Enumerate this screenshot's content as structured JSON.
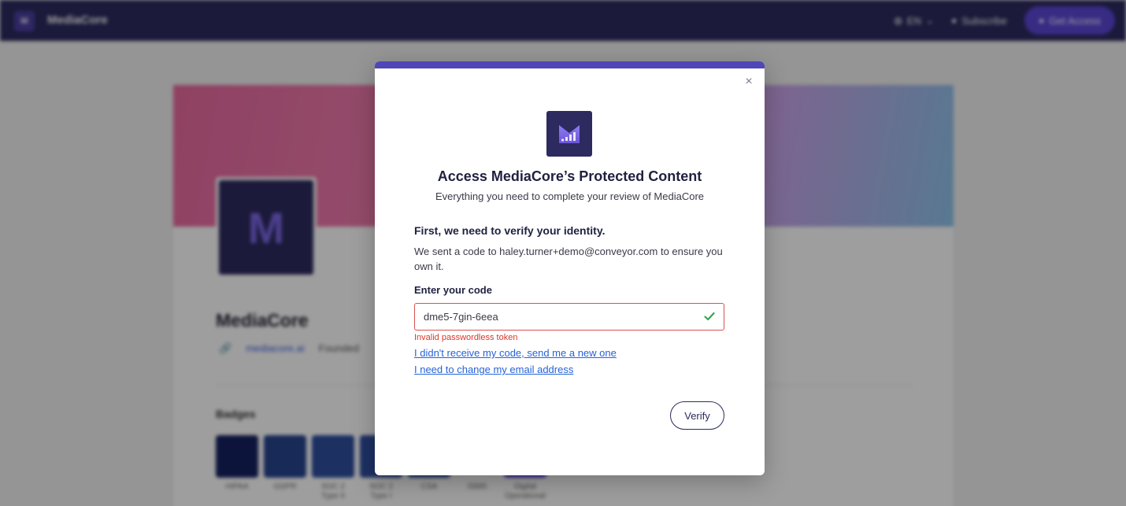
{
  "nav": {
    "brand": "MediaCore",
    "lang": "EN",
    "subscribe": "Subscribe",
    "get_access": "Get Access"
  },
  "company": {
    "name": "MediaCore",
    "website": "mediacore.ai",
    "founded": "Founded"
  },
  "badges": {
    "heading": "Badges",
    "items": [
      "HIPAA",
      "GDPR",
      "SOC 2 Type II",
      "SOC 2 Type I",
      "CSA",
      "ISMS",
      "Digital Operational"
    ]
  },
  "modal": {
    "title": "Access MediaCore’s Protected Content",
    "subtitle": "Everything you need to complete your review of MediaCore",
    "heading": "First, we need to verify your identity.",
    "description": "We sent a code to haley.turner+demo@conveyor.com to ensure you own it.",
    "code_label": "Enter your code",
    "code_value": "dme5-7gin-6eea",
    "error": "Invalid passwordless token",
    "resend_link": "I didn't receive my code, send me a new one",
    "change_email_link": "I need to change my email address",
    "verify_label": "Verify",
    "close_glyph": "×"
  },
  "colors": {
    "nav_bg": "#2c2a5e",
    "accent": "#4f46b8",
    "error": "#d9372b",
    "link": "#2563d8",
    "success": "#34a853"
  }
}
